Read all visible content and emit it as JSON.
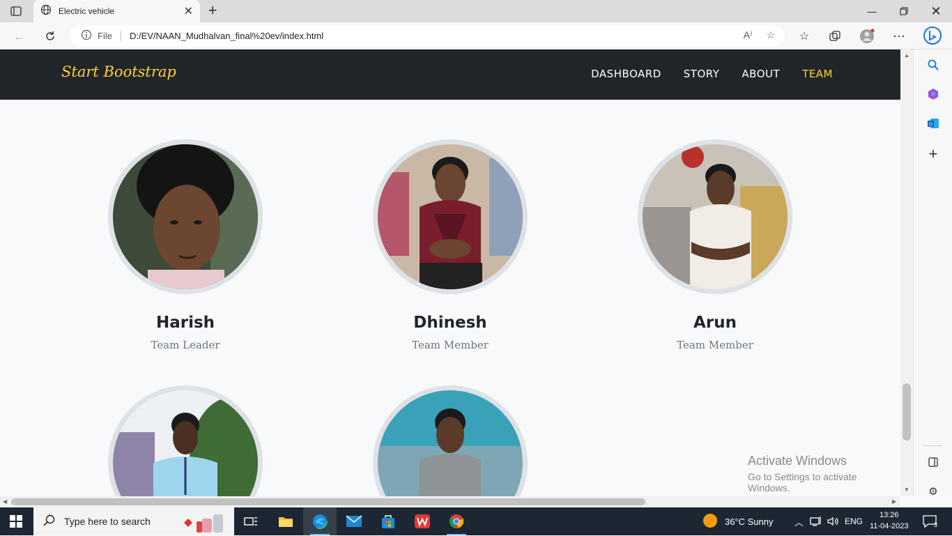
{
  "browser": {
    "tab_title": "Electric vehicle",
    "address_prefix": "File",
    "url": "D:/EV/NAAN_Mudhalvan_final%20ev/index.html",
    "read_aloud_label": "A⁾"
  },
  "site": {
    "brand": "Start Bootstrap",
    "nav": [
      {
        "label": "DASHBOARD",
        "active": false
      },
      {
        "label": "STORY",
        "active": false
      },
      {
        "label": "ABOUT",
        "active": false
      },
      {
        "label": "TEAM",
        "active": true
      }
    ],
    "team": [
      {
        "name": "Harish",
        "role": "Team Leader"
      },
      {
        "name": "Dhinesh",
        "role": "Team Member"
      },
      {
        "name": "Arun",
        "role": "Team Member"
      },
      {
        "name": "",
        "role": ""
      },
      {
        "name": "",
        "role": ""
      }
    ]
  },
  "watermark": {
    "line1": "Activate Windows",
    "line2": "Go to Settings to activate Windows."
  },
  "taskbar": {
    "search_placeholder": "Type here to search",
    "weather": "36°C  Sunny",
    "language": "ENG",
    "time": "13:26",
    "date": "11-04-2023",
    "notifications": "3"
  },
  "colors": {
    "navbar_bg": "#212529",
    "accent": "#fed136",
    "page_bg": "#f8f9fa"
  }
}
